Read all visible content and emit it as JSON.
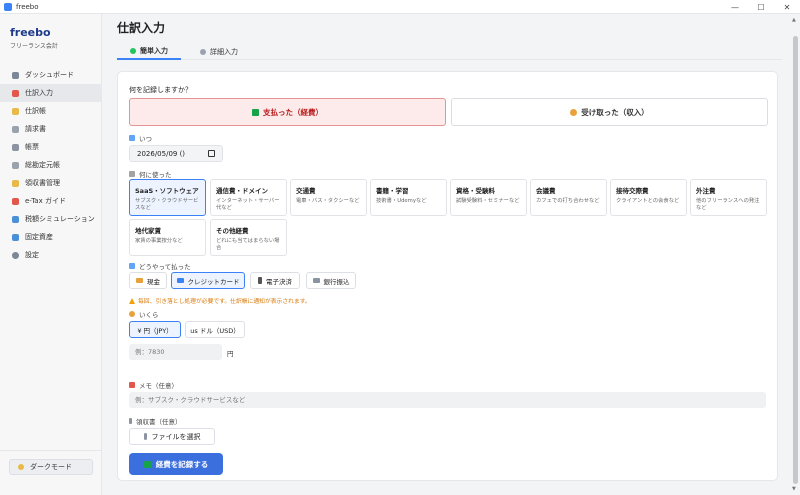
{
  "window": {
    "title": "freebo",
    "controls": [
      "—",
      "☐",
      "✕"
    ]
  },
  "sidebar": {
    "brand": "freebo",
    "brand_sub": "フリーランス会計",
    "items": [
      {
        "label": "ダッシュボード",
        "icon": "dashboard-icon",
        "color": "#7c8896"
      },
      {
        "label": "仕訳入力",
        "icon": "pencil-icon",
        "color": "#e2574c"
      },
      {
        "label": "仕訳帳",
        "icon": "journal-icon",
        "color": "#e9b949"
      },
      {
        "label": "請求書",
        "icon": "invoice-icon",
        "color": "#9aa3ad"
      },
      {
        "label": "帳票",
        "icon": "report-icon",
        "color": "#8b95a1"
      },
      {
        "label": "総勘定元帳",
        "icon": "ledger-icon",
        "color": "#9aa3ad"
      },
      {
        "label": "領収書管理",
        "icon": "receipt-icon",
        "color": "#e9b949"
      },
      {
        "label": "e-Tax ガイド",
        "icon": "etax-icon",
        "color": "#e2574c"
      },
      {
        "label": "税額シミュレーション",
        "icon": "calculator-icon",
        "color": "#4a90d9"
      },
      {
        "label": "固定資産",
        "icon": "asset-icon",
        "color": "#4a90d9"
      },
      {
        "label": "設定",
        "icon": "gear-icon",
        "color": "#7c8896"
      }
    ],
    "dark_mode_label": "ダークモード"
  },
  "main": {
    "title": "仕訳入力",
    "tabs": [
      {
        "label": "簡単入力",
        "active": true
      },
      {
        "label": "詳細入力",
        "active": false
      }
    ],
    "question": "何を記録しますか？",
    "expense_label": "支払った（経費）",
    "income_label": "受け取った（収入）",
    "when_label": "いつ",
    "date_value": "2026/05/09 ()",
    "what_label": "何に使った",
    "categories": [
      {
        "name": "SaaS・ソフトウェア",
        "desc": "サブスク・クラウドサービスなど",
        "selected": true
      },
      {
        "name": "通信費・ドメイン",
        "desc": "インターネット・サーバー代など",
        "selected": false
      },
      {
        "name": "交通費",
        "desc": "電車・バス・タクシーなど",
        "selected": false
      },
      {
        "name": "書籍・学習",
        "desc": "技術書・Udemyなど",
        "selected": false
      },
      {
        "name": "資格・受験料",
        "desc": "試験受験料・セミナーなど",
        "selected": false
      },
      {
        "name": "会議費",
        "desc": "カフェでの打ち合わせなど",
        "selected": false
      },
      {
        "name": "接待交際費",
        "desc": "クライアントとの会食など",
        "selected": false
      },
      {
        "name": "外注費",
        "desc": "他のフリーランスへの発注など",
        "selected": false
      },
      {
        "name": "地代家賃",
        "desc": "家賃の事業按分など",
        "selected": false
      },
      {
        "name": "その他経費",
        "desc": "どれにも当てはまらない場合",
        "selected": false
      }
    ],
    "payment_label": "どうやって払った",
    "payments": [
      {
        "label": "現金",
        "selected": false
      },
      {
        "label": "クレジットカード",
        "selected": true
      },
      {
        "label": "電子決済",
        "selected": false
      },
      {
        "label": "銀行振込",
        "selected": false
      }
    ],
    "warning": "毎回、引き落とし処理が必要です。仕訳帳に通知が表示されます。",
    "amount_label": "いくら",
    "currencies": [
      {
        "label": "¥ 円（JPY）",
        "selected": true
      },
      {
        "label": "us ドル（USD）",
        "selected": false
      }
    ],
    "amount_placeholder": "例：7830",
    "amount_unit": "円",
    "memo_label": "メモ（任意）",
    "memo_placeholder": "例：サブスク・クラウドサービスなど",
    "receipt_label": "領収書（任意）",
    "file_button": "ファイルを選択",
    "submit_label": "経費を記録する"
  },
  "colors": {
    "accent": "#3b82f6",
    "expense": "#b91c1c",
    "submit": "#3b6fde",
    "warning": "#d97706"
  }
}
